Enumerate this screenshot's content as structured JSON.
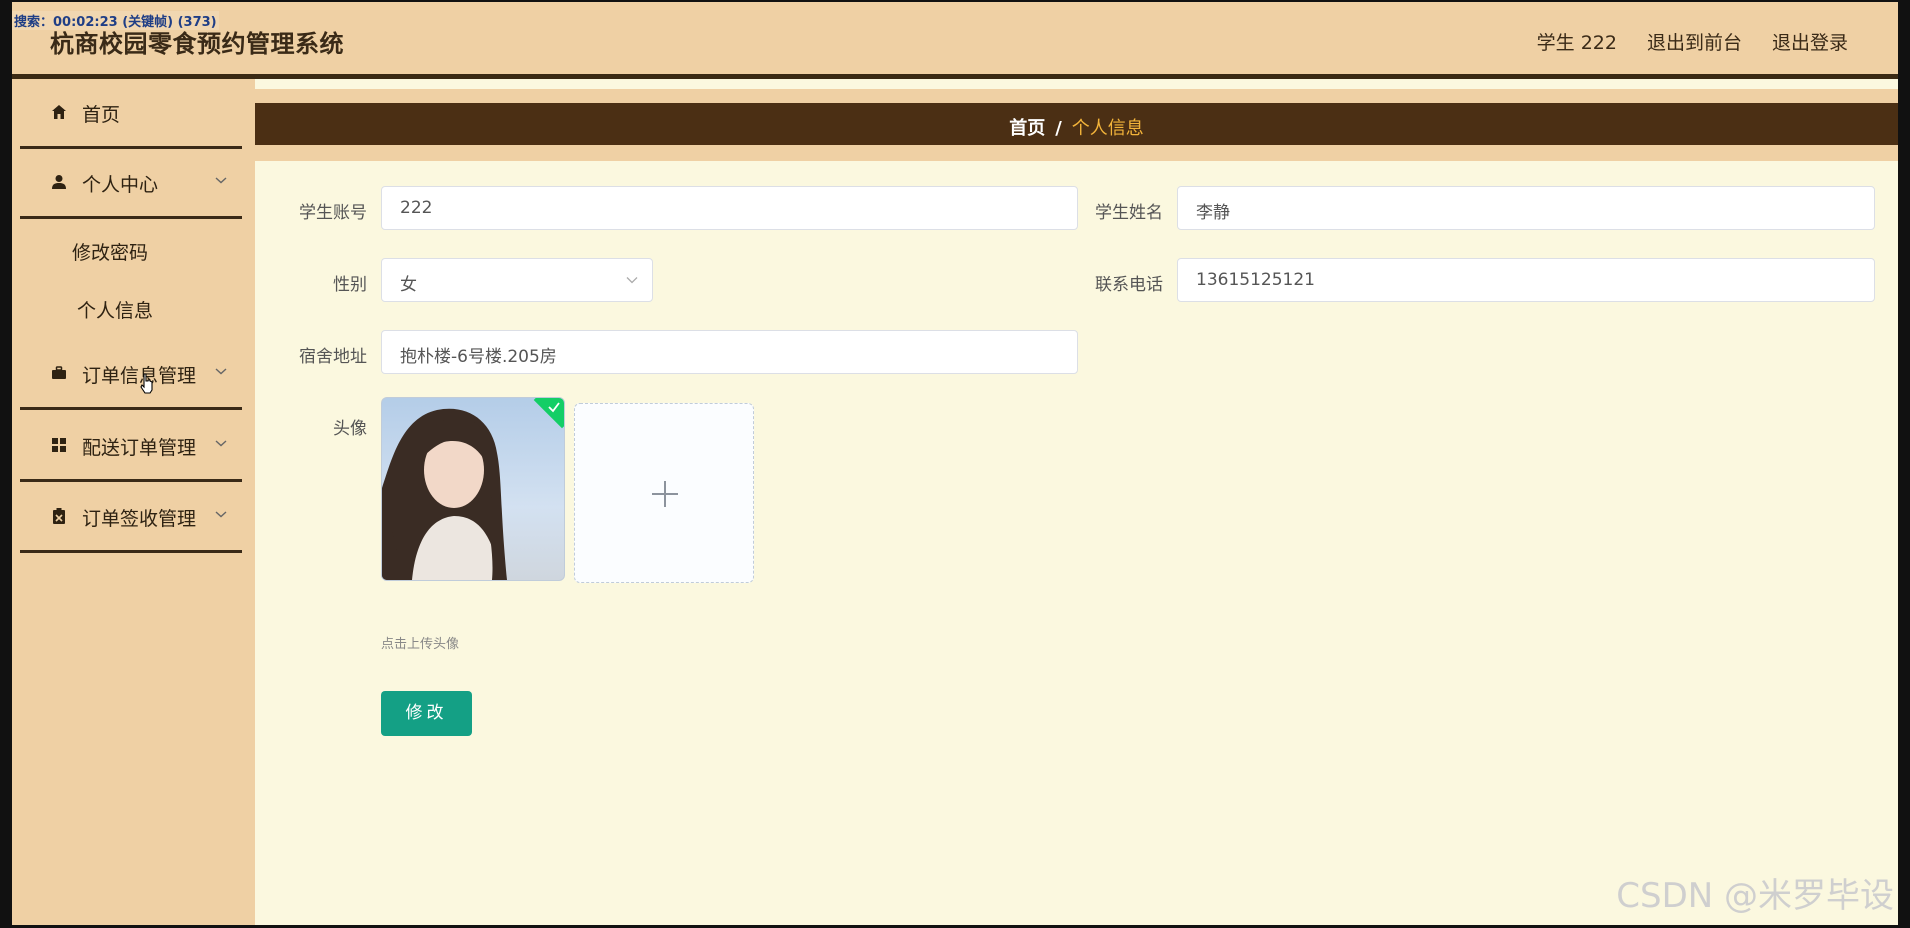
{
  "header": {
    "title": "杭商校园零食预约管理系统",
    "recording_overlay": "搜索：00:02:23 (关键帧) (373)",
    "links": [
      "学生 222",
      "退出到前台",
      "退出登录"
    ]
  },
  "sidebar": {
    "items": [
      {
        "label": "首页",
        "icon": "home-icon"
      },
      {
        "label": "个人中心",
        "icon": "user-icon"
      },
      {
        "label": "订单信息管理",
        "icon": "briefcase-icon"
      },
      {
        "label": "配送订单管理",
        "icon": "grid-icon"
      },
      {
        "label": "订单签收管理",
        "icon": "clipboard-icon"
      }
    ],
    "sub_items": [
      "修改密码",
      "个人信息"
    ]
  },
  "breadcrumb": {
    "home": "首页",
    "separator": "/",
    "current": "个人信息"
  },
  "form": {
    "account_label": "学生账号",
    "account_value": "222",
    "name_label": "学生姓名",
    "name_value": "李静",
    "gender_label": "性别",
    "gender_value": "女",
    "phone_label": "联系电话",
    "phone_value": "13615125121",
    "address_label": "宿舍地址",
    "address_value": "抱朴楼-6号楼.205房",
    "avatar_label": "头像",
    "upload_hint": "点击上传头像",
    "submit_label": "修改"
  },
  "watermark": "CSDN @米罗毕设",
  "colors": {
    "header_bg": "#efd0a4",
    "crumb_bg": "#4b2f14",
    "content_bg": "#fbf8df",
    "button": "#14a085",
    "accent": "#f3b43a"
  }
}
